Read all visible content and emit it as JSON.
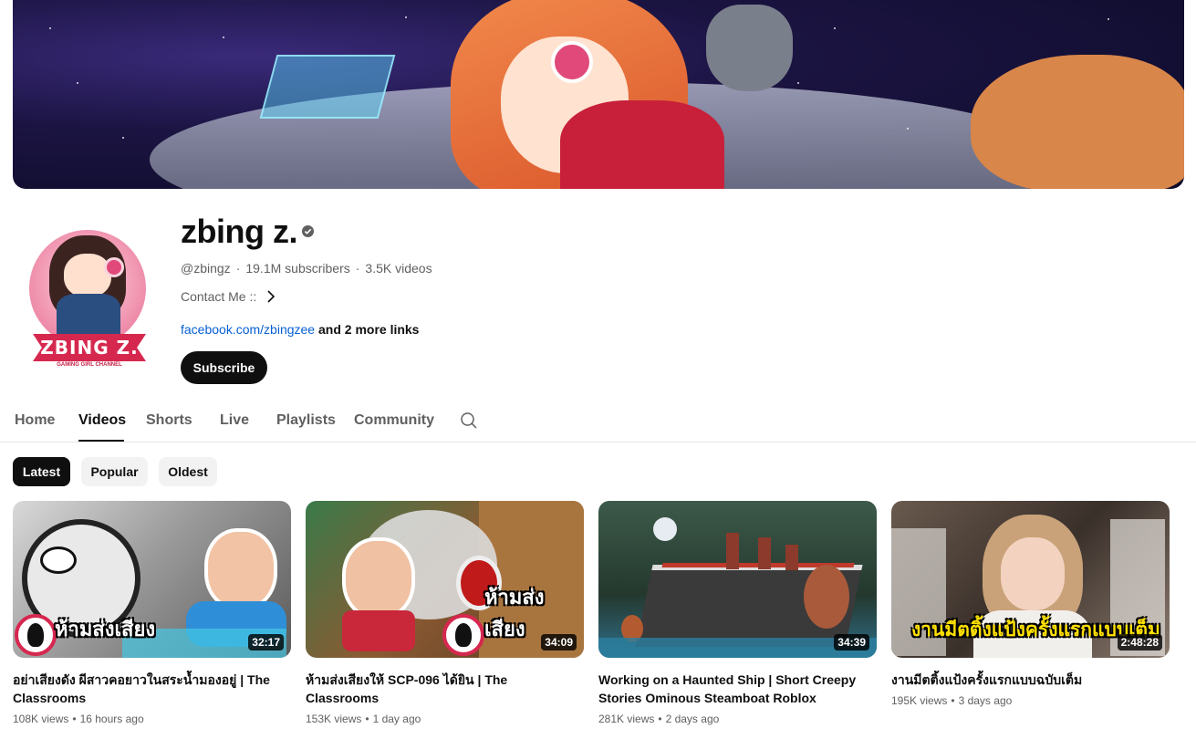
{
  "channel": {
    "name": "zbing z.",
    "handle": "@zbingz",
    "subscribers": "19.1M subscribers",
    "videos_count": "3.5K videos",
    "contact_label": "Contact Me ::",
    "link_primary": "facebook.com/zbingzee",
    "link_more": "and 2 more links",
    "subscribe_label": "Subscribe",
    "avatar_logo_text": "ZBING Z.",
    "avatar_logo_subtext": "GAMING GIRL CHANNEL"
  },
  "tabs": [
    {
      "label": "Home",
      "active": false
    },
    {
      "label": "Videos",
      "active": true
    },
    {
      "label": "Shorts",
      "active": false
    },
    {
      "label": "Live",
      "active": false
    },
    {
      "label": "Playlists",
      "active": false
    },
    {
      "label": "Community",
      "active": false
    }
  ],
  "chips": [
    {
      "label": "Latest",
      "active": true
    },
    {
      "label": "Popular",
      "active": false
    },
    {
      "label": "Oldest",
      "active": false
    }
  ],
  "videos": [
    {
      "title": "อย่าเสียงดัง ผีสาวคอยาวในสระน้ำมองอยู่ | The Classrooms",
      "views": "108K views",
      "age": "16 hours ago",
      "duration": "32:17",
      "overlay_text": "ห้ามส่งเสียง"
    },
    {
      "title": "ห้ามส่งเสียงให้ SCP-096 ได้ยิน | The Classrooms",
      "views": "153K views",
      "age": "1 day ago",
      "duration": "34:09",
      "overlay_text": "ห้ามส่งเสียง"
    },
    {
      "title": "Working on a Haunted Ship | Short Creepy Stories Ominous Steamboat Roblox",
      "views": "281K views",
      "age": "2 days ago",
      "duration": "34:39",
      "overlay_text": ""
    },
    {
      "title": "งานมีตติ้งแป้งครั้งแรกแบบฉบับเต็ม",
      "views": "195K views",
      "age": "3 days ago",
      "duration": "2:48:28",
      "overlay_text": "งานมีตติ้งแป้งครั้งแรกแบบเต็ม"
    }
  ],
  "icons": {
    "verified": "verified-check-icon",
    "contact_chevron": "chevron-right-icon",
    "tab_search": "search-icon"
  },
  "colors": {
    "link": "#065fd4",
    "primary_text": "#0f0f0f",
    "secondary_text": "#606060",
    "chip_bg": "#f2f2f2",
    "brand_pink": "#d6284f"
  }
}
